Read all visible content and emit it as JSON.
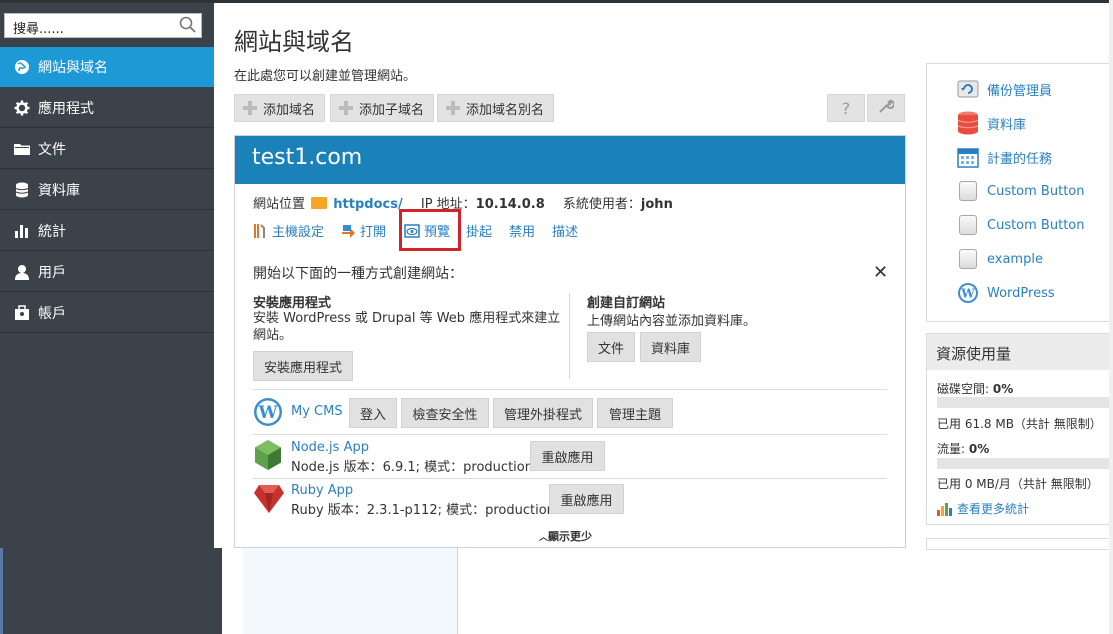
{
  "sidebar": {
    "search_value": "搜尋......",
    "items": [
      {
        "label": "網站與域名",
        "icon": "globe-icon",
        "active": true
      },
      {
        "label": "應用程式",
        "icon": "gear-icon",
        "active": false
      },
      {
        "label": "文件",
        "icon": "folder-icon",
        "active": false
      },
      {
        "label": "資料庫",
        "icon": "database-icon",
        "active": false
      },
      {
        "label": "統計",
        "icon": "bar-chart-icon",
        "active": false
      },
      {
        "label": "用戶",
        "icon": "user-icon",
        "active": false
      },
      {
        "label": "帳戶",
        "icon": "account-icon",
        "active": false
      }
    ]
  },
  "main": {
    "title": "網站與域名",
    "subtitle": "在此處您可以創建並管理網站。",
    "toolbar": {
      "add_domain": "添加域名",
      "add_subdomain": "添加子域名",
      "add_alias": "添加域名別名",
      "help_icon": "?",
      "settings_icon": "wrench"
    }
  },
  "domain": {
    "name": "test1.com",
    "location_label": "網站位置",
    "location_value": "httpdocs/",
    "ip_label": "IP 地址：",
    "ip_value": "10.14.0.8",
    "sysuser_label": "系統使用者：",
    "sysuser_value": "john",
    "actions": {
      "hosting": "主機設定",
      "open": "打開",
      "preview": "預覽",
      "suspend": "掛起",
      "disable": "禁用",
      "describe": "描述"
    },
    "start": {
      "title": "開始以下面的一種方式創建網站：",
      "install_title": "安裝應用程式",
      "install_desc": "安裝 WordPress 或 Drupal 等 Web 應用程式來建立網站。",
      "install_button": "安裝應用程式",
      "custom_title": "創建自訂網站",
      "custom_desc": "上傳網站內容並添加資料庫。",
      "files_button": "文件",
      "db_button": "資料庫"
    },
    "apps": {
      "wp_name": "My CMS",
      "wp_login": "登入",
      "wp_security": "檢查安全性",
      "wp_plugins": "管理外掛程式",
      "wp_themes": "管理主題",
      "node_name": "Node.js App",
      "node_desc": "Node.js 版本：6.9.1; 模式：production",
      "node_restart": "重啟應用",
      "ruby_name": "Ruby App",
      "ruby_desc": "Ruby 版本：2.3.1-p112; 模式：production",
      "ruby_restart": "重啟應用"
    },
    "show_less": "顯示更少"
  },
  "right": {
    "links": [
      {
        "label": "備份管理員",
        "icon": "backup-icon"
      },
      {
        "label": "資料庫",
        "icon": "database-icon"
      },
      {
        "label": "計畫的任務",
        "icon": "calendar-icon"
      },
      {
        "label": "Custom Button",
        "icon": "custom-button-icon"
      },
      {
        "label": "Custom Button",
        "icon": "custom-button-icon"
      },
      {
        "label": "example",
        "icon": "custom-button-icon"
      },
      {
        "label": "WordPress",
        "icon": "wordpress-icon"
      }
    ],
    "resources": {
      "title": "資源使用量",
      "disk_label": "磁碟空間: ",
      "disk_percent": "0%",
      "disk_used": "已用 61.8 MB（共計 無限制）",
      "traffic_label": "流量: ",
      "traffic_percent": "0%",
      "traffic_used": "已用 0 MB/月（共計 無限制）",
      "more_stats": "查看更多統計"
    }
  },
  "colors": {
    "sidebar_bg": "#3b4249",
    "active_blue": "#1d9ad6",
    "card_header": "#1a82b8",
    "link": "#2a7fc1",
    "highlight_red": "#d0242a"
  }
}
